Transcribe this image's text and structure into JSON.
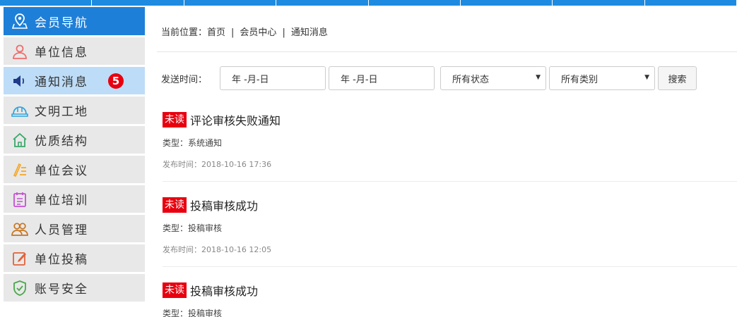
{
  "sidebar": {
    "items": [
      {
        "label": "会员导航",
        "icon": "map-marker-icon"
      },
      {
        "label": "单位信息",
        "icon": "user-icon"
      },
      {
        "label": "通知消息",
        "icon": "speaker-icon",
        "badge": "5"
      },
      {
        "label": "文明工地",
        "icon": "helmet-icon"
      },
      {
        "label": "优质结构",
        "icon": "home-icon"
      },
      {
        "label": "单位会议",
        "icon": "pen-list-icon"
      },
      {
        "label": "单位培训",
        "icon": "clipboard-icon"
      },
      {
        "label": "人员管理",
        "icon": "people-icon"
      },
      {
        "label": "单位投稿",
        "icon": "edit-icon"
      },
      {
        "label": "账号安全",
        "icon": "shield-icon"
      }
    ]
  },
  "breadcrumb": {
    "prefix": "当前位置：",
    "home": "首页",
    "sep": "|",
    "center": "会员中心",
    "current": "通知消息"
  },
  "filter": {
    "label": "发送时间：",
    "date_start": "年 -月-日",
    "date_end": "年 -月-日",
    "status": "所有状态",
    "category": "所有类别",
    "search": "搜索"
  },
  "notices": [
    {
      "unread": "未读",
      "title": "评论审核失败通知",
      "type": "类型：系统通知",
      "time": "发布时间：2018-10-16 17:36"
    },
    {
      "unread": "未读",
      "title": "投稿审核成功",
      "type": "类型：投稿审核",
      "time": "发布时间：2018-10-16 12:05"
    },
    {
      "unread": "未读",
      "title": "投稿审核成功",
      "type": "类型：投稿审核",
      "time": ""
    }
  ],
  "colors": {
    "accent": "#1e7fd8",
    "active": "#bddcf7",
    "badge": "#e8000f",
    "unread": "#e8000f"
  }
}
